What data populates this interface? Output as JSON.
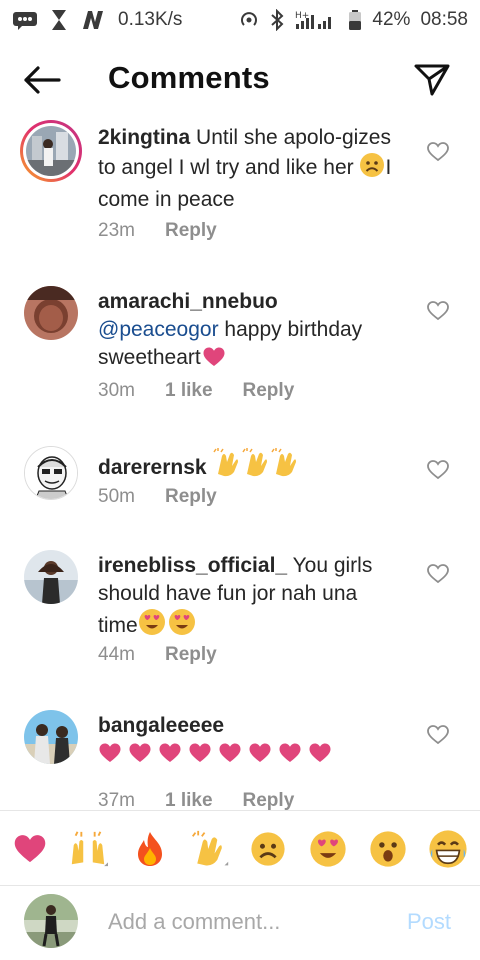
{
  "status_bar": {
    "speed": "0.13K/s",
    "battery": "42%",
    "time": "08:58"
  },
  "header": {
    "title": "Comments"
  },
  "comments": [
    {
      "username": "2kingtina",
      "text_1": "Until she apolo-gizes to angel I wl try and like her",
      "emoji_1": "frowning-face",
      "text_2": "I come in peace",
      "time": "23m",
      "reply": "Reply"
    },
    {
      "username": "amarachi_nnebuo",
      "mention": "@peaceogor",
      "text_1": "happy birthday sweetheart",
      "emoji_1": "pink-heart",
      "time": "30m",
      "likes": "1 like",
      "reply": "Reply"
    },
    {
      "username": "darerernsk",
      "emoji_1": "clapping-hands x3",
      "time": "50m",
      "reply": "Reply"
    },
    {
      "username": "irenebliss_official_",
      "text_1": "You girls should have fun jor nah una time",
      "emoji_1": "heart-eyes x2",
      "time": "44m",
      "reply": "Reply"
    },
    {
      "username": "bangaleeeee",
      "emoji_1": "pink-heart x8",
      "time": "37m",
      "likes": "1 like",
      "reply": "Reply"
    }
  ],
  "emoji_bar": [
    "heart",
    "raising-hands",
    "fire",
    "clapping-hands",
    "frowning-face",
    "heart-eyes",
    "surprised-face",
    "grinning-face"
  ],
  "composer": {
    "placeholder": "Add a comment...",
    "post_label": "Post"
  },
  "colors": {
    "accent_link": "#1a4d8f",
    "post_disabled": "#b3dbff",
    "muted": "#8e8e8e",
    "pink_heart": "#e0457b"
  }
}
